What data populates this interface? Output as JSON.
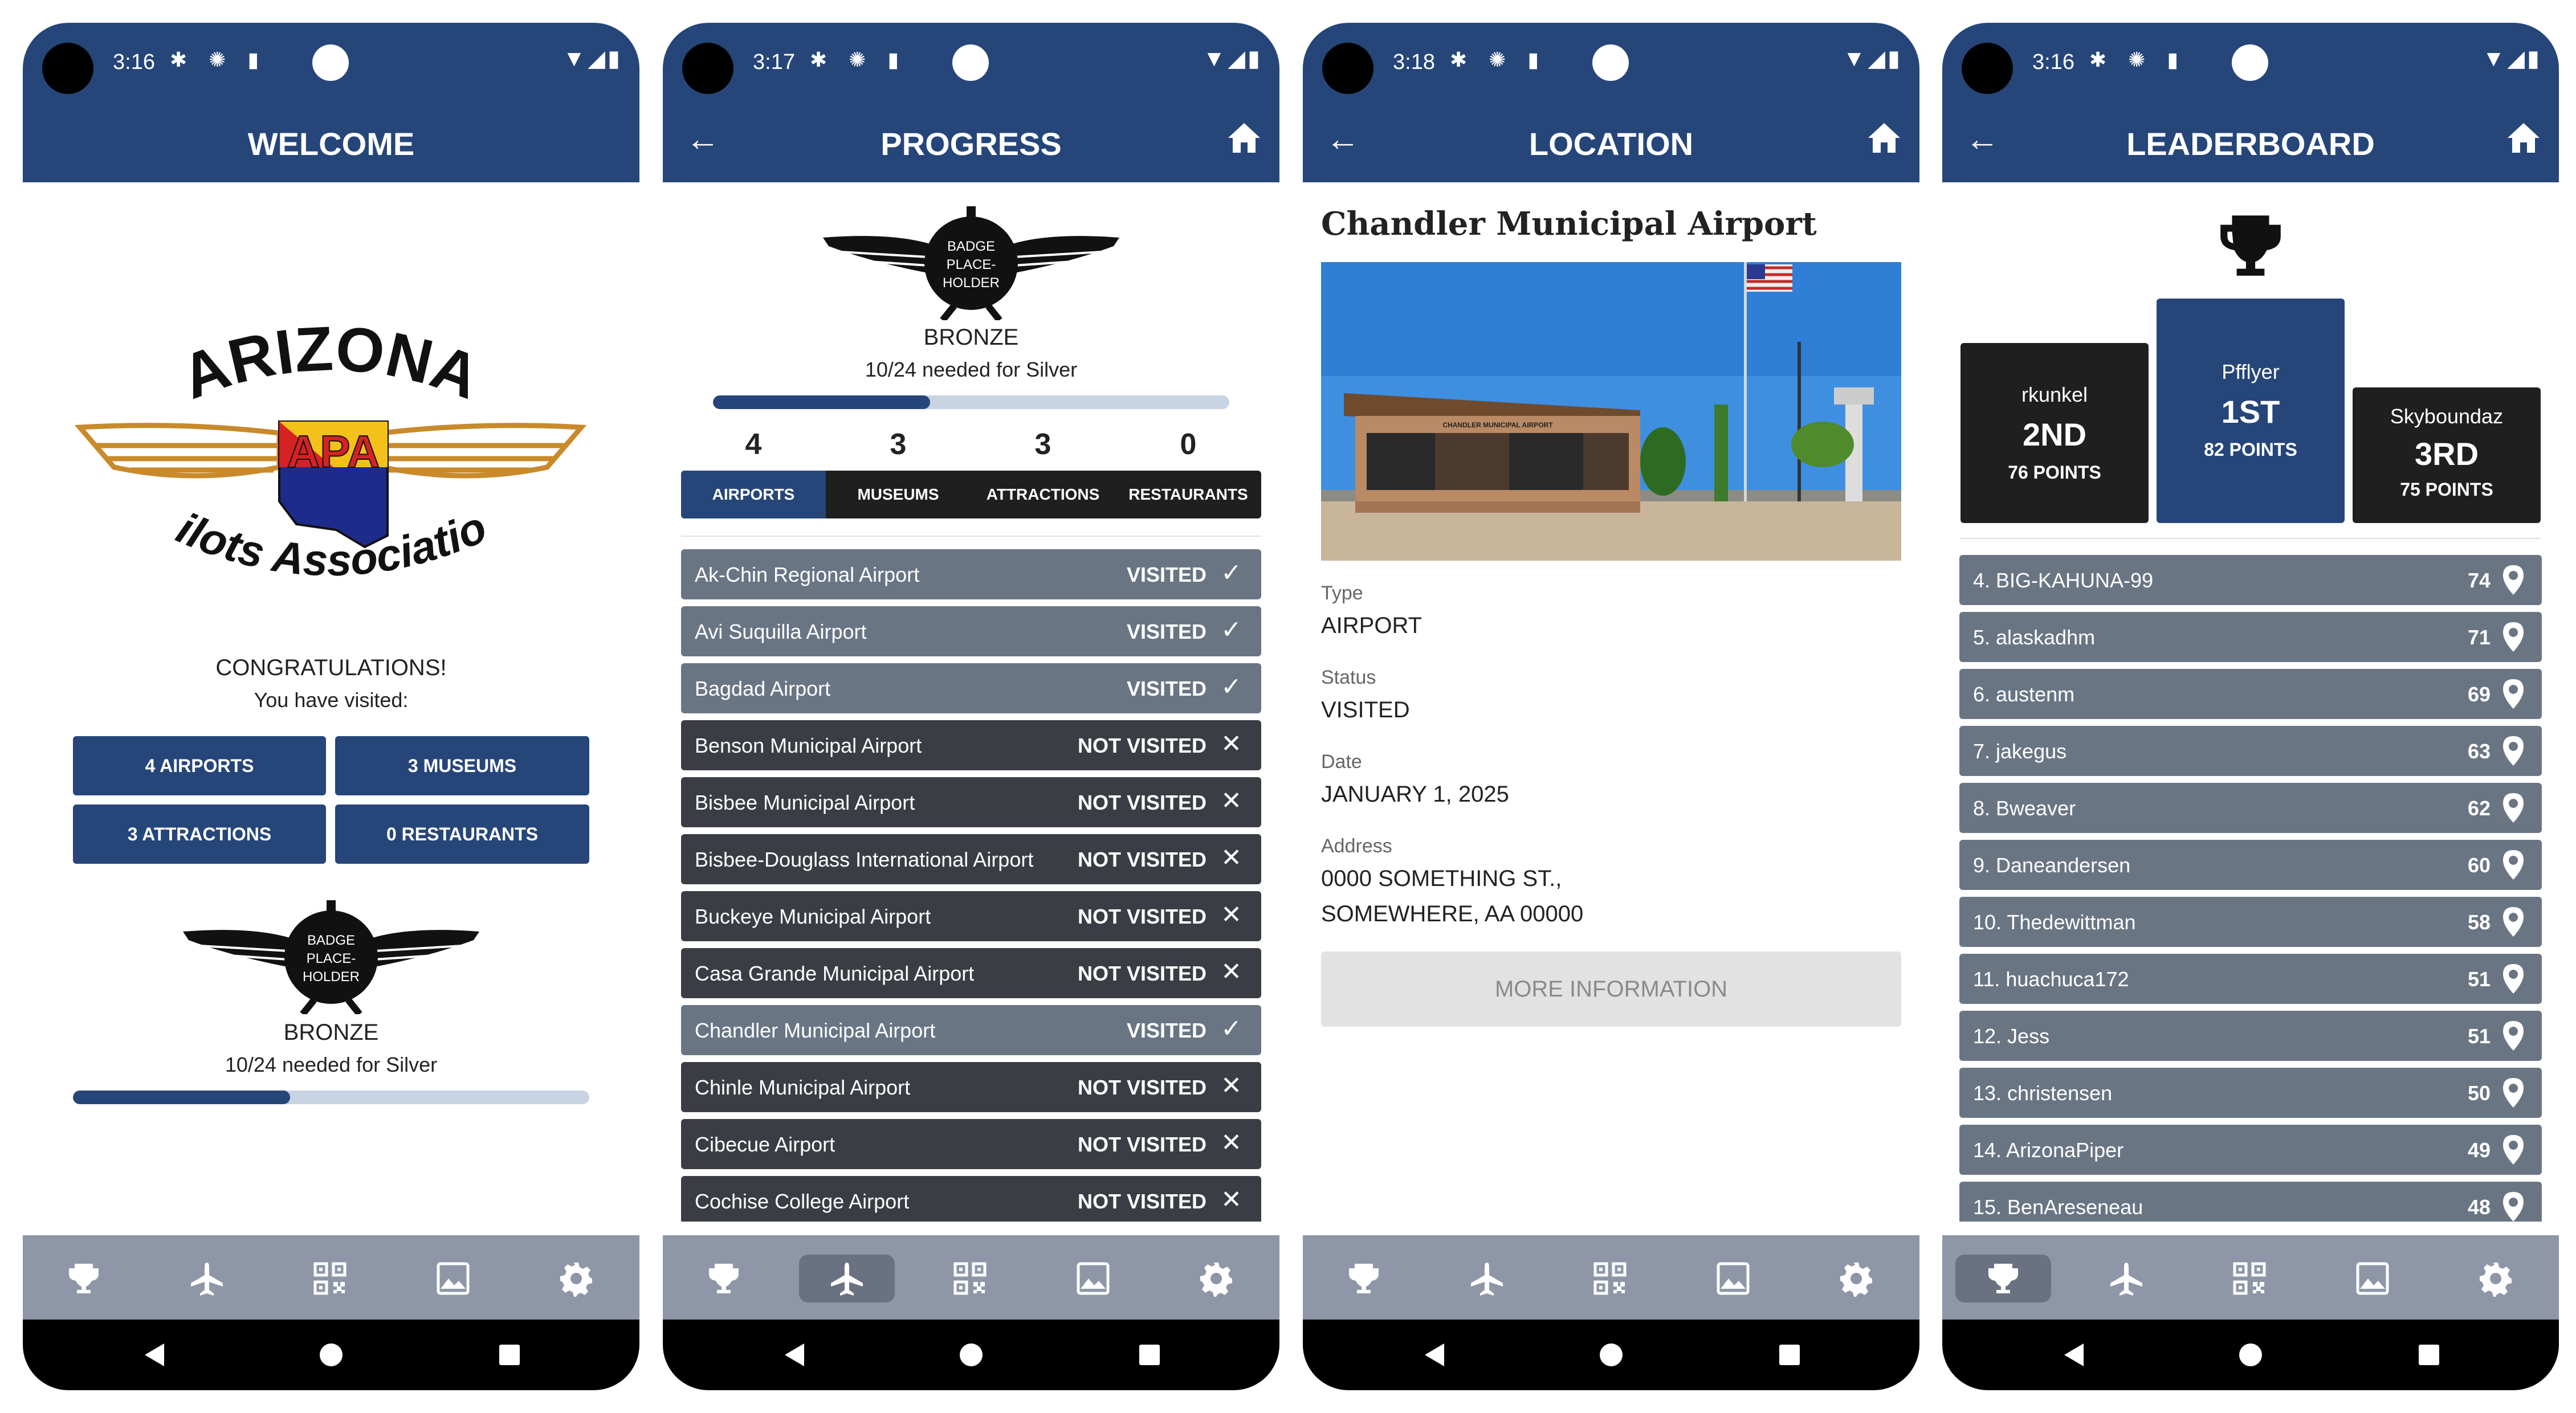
{
  "status": {
    "icons": "✱ ✺ ▮",
    "net": "▼◢▮"
  },
  "nav": {
    "back": "◀",
    "home": "●",
    "recents": "■"
  },
  "common": {
    "back_arrow": "←"
  },
  "screens": [
    {
      "time": "3:16",
      "title": "WELCOME"
    },
    {
      "time": "3:17",
      "title": "PROGRESS"
    },
    {
      "time": "3:18",
      "title": "LOCATION"
    },
    {
      "time": "3:16",
      "title": "LEADERBOARD"
    }
  ],
  "tabs": [
    "trophy-icon",
    "airplane-icon",
    "qr-code-icon",
    "gallery-icon",
    "gear-icon"
  ],
  "welcome": {
    "logo_top": "ARIZONA",
    "logo_mid": "APA",
    "logo_bottom": "Pilots Association",
    "congrats": "CONGRATULATIONS!",
    "visited_prompt": "You have visited:",
    "buttons": [
      "4 AIRPORTS",
      "3 MUSEUMS",
      "3 ATTRACTIONS",
      "0 RESTAURANTS"
    ],
    "badge_text": [
      "BADGE",
      "PLACE-",
      "HOLDER"
    ],
    "badge_level": "BRONZE",
    "badge_needed": "10/24 needed for Silver",
    "progress": 0.42
  },
  "progress": {
    "badge_text": [
      "BADGE",
      "PLACE-",
      "HOLDER"
    ],
    "badge_level": "BRONZE",
    "badge_needed": "10/24 needed for Silver",
    "progress": 0.42,
    "counts": [
      {
        "count": "4",
        "label": "AIRPORTS"
      },
      {
        "count": "3",
        "label": "MUSEUMS"
      },
      {
        "count": "3",
        "label": "ATTRACTIONS"
      },
      {
        "count": "0",
        "label": "RESTAURANTS"
      }
    ],
    "airports": [
      {
        "name": "Ak-Chin Regional Airport",
        "status": "VISITED",
        "visited": true
      },
      {
        "name": "Avi Suquilla Airport",
        "status": "VISITED",
        "visited": true
      },
      {
        "name": "Bagdad Airport",
        "status": "VISITED",
        "visited": true
      },
      {
        "name": "Benson Municipal Airport",
        "status": "NOT VISITED",
        "visited": false
      },
      {
        "name": "Bisbee Municipal Airport",
        "status": "NOT VISITED",
        "visited": false
      },
      {
        "name": "Bisbee-Douglass International Airport",
        "status": "NOT VISITED",
        "visited": false
      },
      {
        "name": "Buckeye Municipal Airport",
        "status": "NOT VISITED",
        "visited": false
      },
      {
        "name": "Casa Grande Municipal Airport",
        "status": "NOT VISITED",
        "visited": false
      },
      {
        "name": "Chandler Municipal Airport",
        "status": "VISITED",
        "visited": true
      },
      {
        "name": "Chinle Municipal Airport",
        "status": "NOT VISITED",
        "visited": false
      },
      {
        "name": "Cibecue Airport",
        "status": "NOT VISITED",
        "visited": false
      },
      {
        "name": "Cochise College Airport",
        "status": "NOT VISITED",
        "visited": false
      }
    ],
    "icon_visited": "✓",
    "icon_not_visited": "✕"
  },
  "location": {
    "name": "Chandler Municipal Airport",
    "photo_sign": "CHANDLER MUNICIPAL AIRPORT",
    "fields": [
      {
        "label": "Type",
        "value": "AIRPORT"
      },
      {
        "label": "Status",
        "value": "VISITED"
      },
      {
        "label": "Date",
        "value": "JANUARY 1, 2025"
      },
      {
        "label": "Address",
        "value": "0000 SOMETHING ST.,",
        "value2": "SOMEWHERE, AA 00000"
      }
    ],
    "more_button": "MORE INFORMATION"
  },
  "leaderboard": {
    "podium": [
      {
        "user": "Pfflyer",
        "rank": "1ST",
        "points": "82 POINTS"
      },
      {
        "user": "rkunkel",
        "rank": "2ND",
        "points": "76 POINTS"
      },
      {
        "user": "Skyboundaz",
        "rank": "3RD",
        "points": "75 POINTS"
      }
    ],
    "rows": [
      {
        "name": "4. BIG-KAHUNA-99",
        "points": "74"
      },
      {
        "name": "5. alaskadhm",
        "points": "71"
      },
      {
        "name": "6. austenm",
        "points": "69"
      },
      {
        "name": "7. jakegus",
        "points": "63"
      },
      {
        "name": "8. Bweaver",
        "points": "62"
      },
      {
        "name": "9. Daneandersen",
        "points": "60"
      },
      {
        "name": "10. Thedewittman",
        "points": "58"
      },
      {
        "name": "11. huachuca172",
        "points": "51"
      },
      {
        "name": "12. Jess",
        "points": "51"
      },
      {
        "name": "13. christensen",
        "points": "50"
      },
      {
        "name": "14. ArizonaPiper",
        "points": "49"
      },
      {
        "name": "15. BenAreseneau",
        "points": "48"
      }
    ]
  }
}
